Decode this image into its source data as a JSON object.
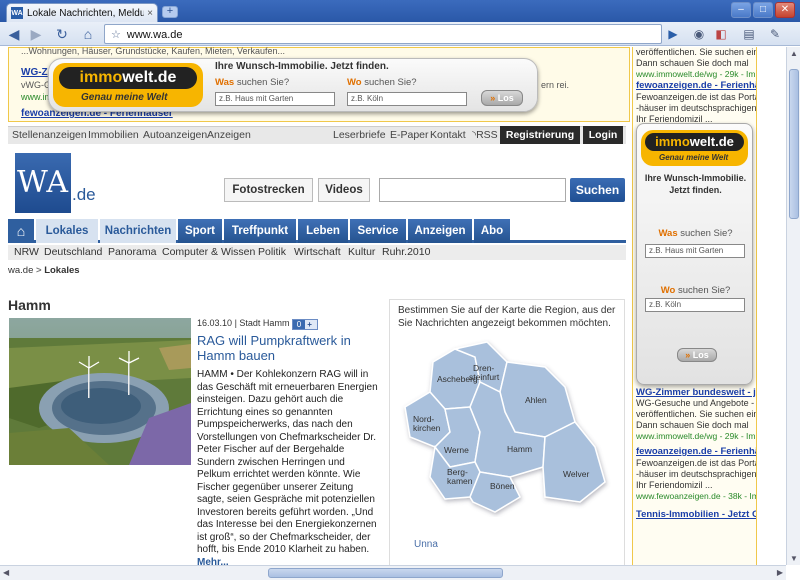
{
  "browser": {
    "tab_title": "Lokale Nachrichten, Meldun...",
    "tab_close": "×",
    "new_tab": "+",
    "url": "www.wa.de",
    "favicon_text": "WA",
    "window_buttons": {
      "minimize": "–",
      "maximize": "□",
      "close": "✕"
    },
    "nav_glyphs": {
      "back": "◀",
      "forward": "▶",
      "reload": "↻",
      "home": "⌂",
      "star": "☆",
      "go": "▶"
    },
    "toolbar_glyphs": {
      "camera": "◉",
      "extension": "◧",
      "page": "▤",
      "wrench": "✎"
    }
  },
  "top_ad": {
    "line1": "...Wohnungen, Häuser, Grundstücke, Kaufen, Mieten, Verkaufen...",
    "link2": "WG-Z",
    "line3": "vWG-G",
    "line4": "www.im",
    "tail": "ern rei.",
    "link5": "fewoanzeigen.de - Ferienhäuser"
  },
  "immowelt": {
    "logo_a": "immo",
    "logo_b": "welt.de",
    "tagline": "Genau meine Welt",
    "headline": "Ihre Wunsch-Immobilie. Jetzt finden.",
    "headline_side": "Ihre Wunsch-Immobilie. Jetzt finden.",
    "was_label_a": "Was",
    "was_label_b": " suchen Sie?",
    "wo_label_a": "Wo",
    "wo_label_b": " suchen Sie?",
    "was_placeholder": "z.B. Haus mit Garten",
    "wo_placeholder": "z.B. Köln",
    "button": "Los",
    "button_glyph": "»"
  },
  "service_links": [
    "Stellenanzeigen",
    "Immobilien",
    "Autoanzeigen",
    "Anzeigen"
  ],
  "util_links": [
    "Leserbriefe",
    "E-Paper",
    "Kontakt",
    "RSS"
  ],
  "rss_glyph": "◝",
  "register": "Registrierung",
  "login": "Login",
  "logo": {
    "main": "WA",
    "suffix": ".de"
  },
  "top_buttons": {
    "fotostrecken": "Fotostrecken",
    "videos": "Videos",
    "suchen": "Suchen"
  },
  "nav": {
    "home_glyph": "⌂",
    "tabs": [
      "Lokales",
      "Nachrichten",
      "Sport",
      "Treffpunkt",
      "Leben",
      "Service",
      "Anzeigen",
      "Abo"
    ]
  },
  "subnav": [
    "NRW",
    "Deutschland",
    "Panorama",
    "Computer & Wissen",
    "Politik",
    "Wirtschaft",
    "Kultur",
    "Ruhr.2010"
  ],
  "breadcrumb": {
    "home": "wa.de",
    "sep": ">",
    "current": "Lokales"
  },
  "section_title": "Hamm",
  "article": {
    "date": "16.03.10",
    "sep": "|",
    "location": "Stadt Hamm",
    "sep2": "|",
    "comments": "0",
    "plus": "+",
    "headline": "RAG will Pumpkraftwerk in Hamm bauen",
    "teaser": "HAMM • Der Kohlekonzern RAG will in das Geschäft mit erneuerbaren Energien einsteigen. Dazu gehört auch die Errichtung eines so genannten Pumpspeicherwerks, das nach den Vorstellungen von Chefmarkscheider Dr. Peter Fischer auf der Bergehalde Sundern zwischen Herringen und Pelkum errichtet werden könnte. Wie Fischer gegenüber unserer Zeitung sagte, seien Gespräche mit potenziellen Investoren bereits geführt worden. „Und das Interesse bei den Energiekonzernen ist groß“, so der Chefmarkscheider, der hofft, bis Ende 2010 Klarheit zu haben.",
    "more": "Mehr..."
  },
  "map": {
    "intro": "Bestimmen Sie auf der Karte die Region, aus der Sie Nachrichten angezeigt bekommen möchten.",
    "regions": {
      "drensteinfurt_a": "Dren-",
      "drensteinfurt_b": "steinfurt",
      "ascheberg": "Ascheberg",
      "ahlen": "Ahlen",
      "nordkirchen_a": "Nord-",
      "nordkirchen_b": "kirchen",
      "werne": "Werne",
      "hamm": "Hamm",
      "bergkamen_a": "Berg-",
      "bergkamen_b": "kamen",
      "boenen": "Bönen",
      "welver": "Welver"
    },
    "below": "Unna"
  },
  "right_ads": {
    "top1": "veröffentlichen. Sie suchen eine",
    "top2": "Dann schauen Sie doch mal",
    "top2_url": "www.immowelt.de/wg - 29k - Im C",
    "link_a": "fewoanzeigen.de - Ferienhä",
    "a1": "Fewoanzeigen.de ist das Portal",
    "a2": "-häuser im deutschsprachigen E",
    "a3": "Ihr Feriendomizil ...",
    "b0": "WG-Zimmer bundesweit - jetzt",
    "b1": "WG-Gesuche und Angebote - Im",
    "b2": "veröffentlichen. Sie suchen eine",
    "b3": "Dann schauen Sie doch mal",
    "b_url": "www.immowelt.de/wg - 29k - Im C",
    "link_c": "fewoanzeigen.de - Ferienhä",
    "c1": "Fewoanzeigen.de ist das Portal",
    "c2": "-häuser im deutschsprachigen E",
    "c3": "Ihr Feriendomizil ...",
    "c_url": "www.fewoanzeigen.de - 38k - Im",
    "d0": "Tennis-Immobilien - Jetzt G"
  },
  "colors": {
    "brand_blue": "#2a5a9a",
    "immowelt_yellow": "#f7b500",
    "ad_link": "#1a3ea8"
  }
}
